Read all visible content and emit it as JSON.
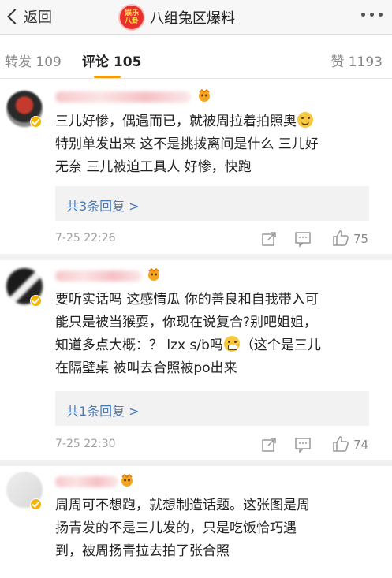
{
  "header": {
    "back_label": "返回",
    "title": "八组兔区爆料",
    "brand_text": "娱乐八卦"
  },
  "tabs": {
    "repost": "转发 109",
    "comments": "评论 105",
    "likes": "赞 1193"
  },
  "comments": [
    {
      "line1": "三儿好惨，偶遇而已，就被周拉着拍照奥",
      "line2": "特别单发出来 这不是挑拨离间是什么 三儿好",
      "line3": "无奈 三儿被迫工具人 好惨，快跑",
      "replies": "共3条回复 >",
      "time": "7-25 22:26",
      "likes": "75"
    },
    {
      "line1": "要听实话吗 这感情瓜 你的善良和自我带入可",
      "line2": "能只是被当猴耍，你现在说复合?别吧姐姐，",
      "line3a": "知道多点大概：？ lzx s/b吗",
      "line3b": "（这个是三儿",
      "line4": "在隔壁桌 被叫去合照被po出来",
      "replies": "共1条回复 >",
      "time": "7-25 22:30",
      "likes": "74"
    },
    {
      "line1": "周周可不想跑，就想制造话题。这张图是周",
      "line2": "扬青发的不是三儿发的，只是吃饭恰巧遇",
      "line3": "到，被周扬青拉去拍了张合照"
    }
  ],
  "colors": {
    "link": "#4a7bb5",
    "accent": "#f39c12",
    "badge": "#f6b400"
  }
}
